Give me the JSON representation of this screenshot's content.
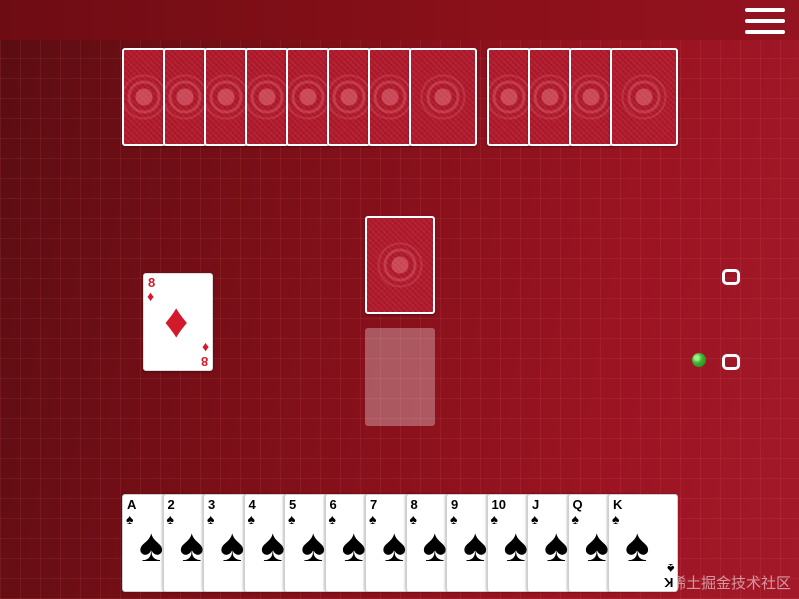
{
  "topbar": {
    "menu_icon": "hamburger-menu-icon"
  },
  "opponent_hand": {
    "card_count": 12,
    "card_face": "back"
  },
  "center": {
    "draw_pile": {
      "card_face": "back"
    },
    "discard_slot": {
      "state": "empty"
    }
  },
  "played_card": {
    "rank": "8",
    "suit": "♦",
    "suit_name": "diamonds",
    "color": "#d11b2a"
  },
  "player_hand": {
    "suit": "♠",
    "suit_name": "spades",
    "cards": [
      {
        "rank": "A"
      },
      {
        "rank": "2"
      },
      {
        "rank": "3"
      },
      {
        "rank": "4"
      },
      {
        "rank": "5"
      },
      {
        "rank": "6"
      },
      {
        "rank": "7"
      },
      {
        "rank": "8"
      },
      {
        "rank": "9"
      },
      {
        "rank": "10"
      },
      {
        "rank": "J"
      },
      {
        "rank": "Q"
      },
      {
        "rank": "K"
      }
    ]
  },
  "scores": {
    "opponent": "0",
    "player": "0"
  },
  "turn_indicator": {
    "color": "#3fb531",
    "icon": "green-dot-icon"
  },
  "watermark": "@稀土掘金技术社区"
}
